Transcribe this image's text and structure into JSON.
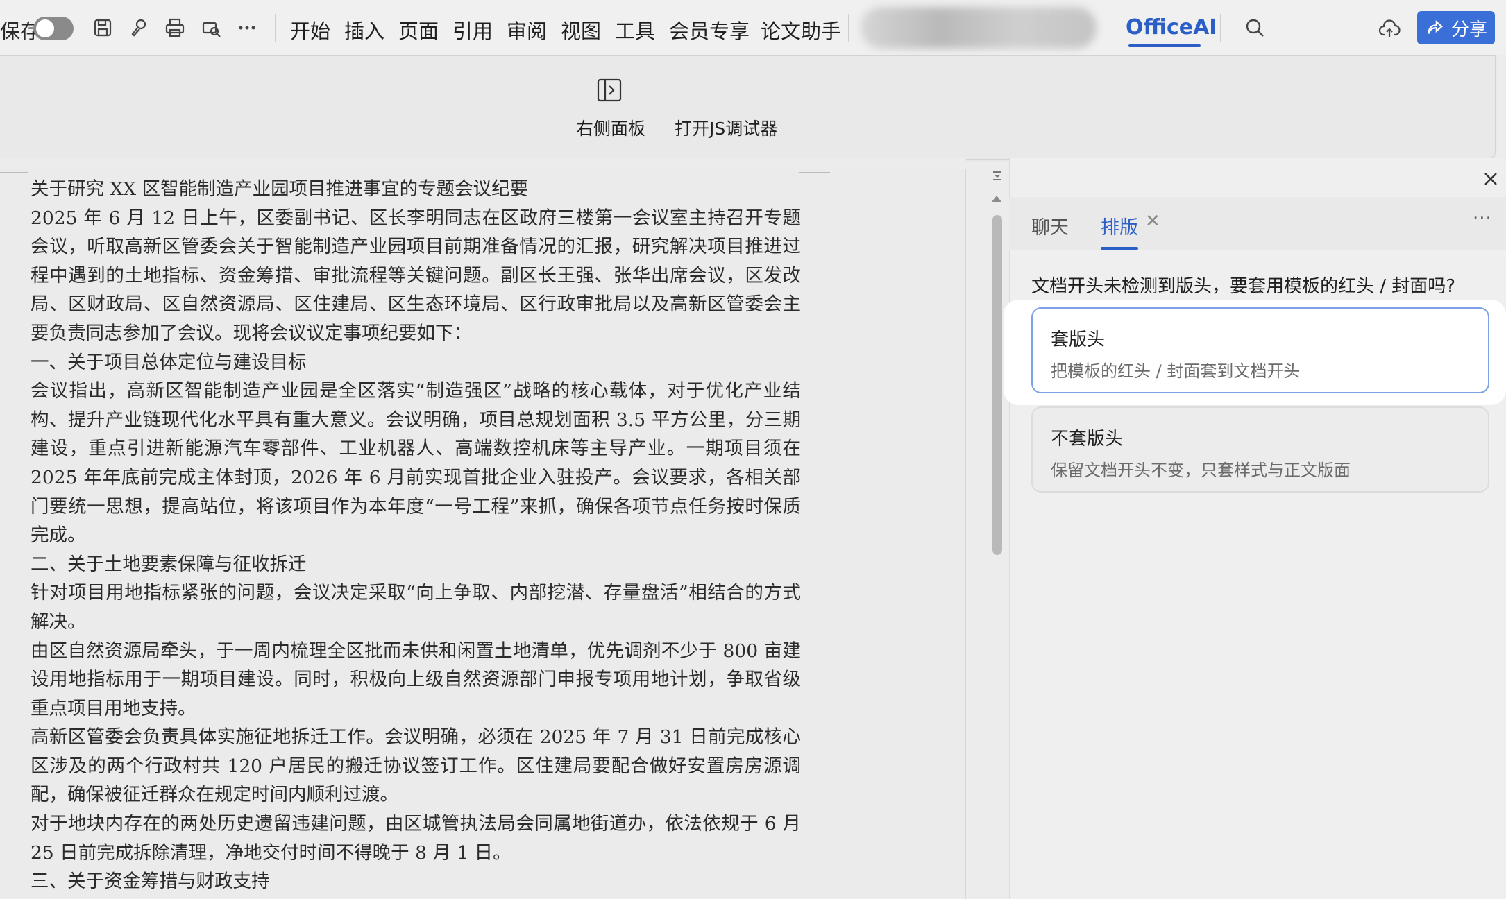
{
  "toolbar": {
    "save_label": "保存",
    "menu": [
      "开始",
      "插入",
      "页面",
      "引用",
      "审阅",
      "视图",
      "工具",
      "会员专享",
      "论文助手"
    ],
    "officeai_tab": "OfficeAI",
    "share_label": "分享"
  },
  "ribbon": {
    "right_panel_label": "右侧面板",
    "js_debugger_label": "打开JS调试器"
  },
  "document": {
    "paragraphs": [
      "关于研究 XX 区智能制造产业园项目推进事宜的专题会议纪要",
      "2025 年 6 月 12 日上午，区委副书记、区长李明同志在区政府三楼第一会议室主持召开专题会议，听取高新区管委会关于智能制造产业园项目前期准备情况的汇报，研究解决项目推进过程中遇到的土地指标、资金筹措、审批流程等关键问题。副区长王强、张华出席会议，区发改局、区财政局、区自然资源局、区住建局、区生态环境局、区行政审批局以及高新区管委会主要负责同志参加了会议。现将会议议定事项纪要如下：",
      "一、关于项目总体定位与建设目标",
      "会议指出，高新区智能制造产业园是全区落实“制造强区”战略的核心载体，对于优化产业结构、提升产业链现代化水平具有重大意义。会议明确，项目总规划面积 3.5 平方公里，分三期建设，重点引进新能源汽车零部件、工业机器人、高端数控机床等主导产业。一期项目须在 2025 年年底前完成主体封顶，2026 年 6 月前实现首批企业入驻投产。会议要求，各相关部门要统一思想，提高站位，将该项目作为本年度“一号工程”来抓，确保各项节点任务按时保质完成。",
      "二、关于土地要素保障与征收拆迁",
      "针对项目用地指标紧张的问题，会议决定采取“向上争取、内部挖潜、存量盘活”相结合的方式解决。",
      "由区自然资源局牵头，于一周内梳理全区批而未供和闲置土地清单，优先调剂不少于 800 亩建设用地指标用于一期项目建设。同时，积极向上级自然资源部门申报专项用地计划，争取省级重点项目用地支持。",
      "高新区管委会负责具体实施征地拆迁工作。会议明确，必须在 2025 年 7 月 31 日前完成核心区涉及的两个行政村共 120 户居民的搬迁协议签订工作。区住建局要配合做好安置房房源调配，确保被征迁群众在规定时间内顺利过渡。",
      "对于地块内存在的两处历史遗留违建问题，由区城管执法局会同属地街道办，依法依规于 6 月 25 日前完成拆除清理，净地交付时间不得晚于 8 月 1 日。",
      "三、关于资金筹措与财政支持"
    ]
  },
  "panel": {
    "tabs": {
      "chat": "聊天",
      "format": "排版"
    },
    "prompt": "文档开头未检测到版头，要套用模板的红头 / 封面吗?",
    "options": [
      {
        "title": "套版头",
        "desc": "把模板的红头 / 封面套到文档开头"
      },
      {
        "title": "不套版头",
        "desc": "保留文档开头不变，只套样式与正文版面"
      }
    ]
  },
  "colors": {
    "accent": "#2b5fc7",
    "share_bg": "#3a6fd8"
  }
}
